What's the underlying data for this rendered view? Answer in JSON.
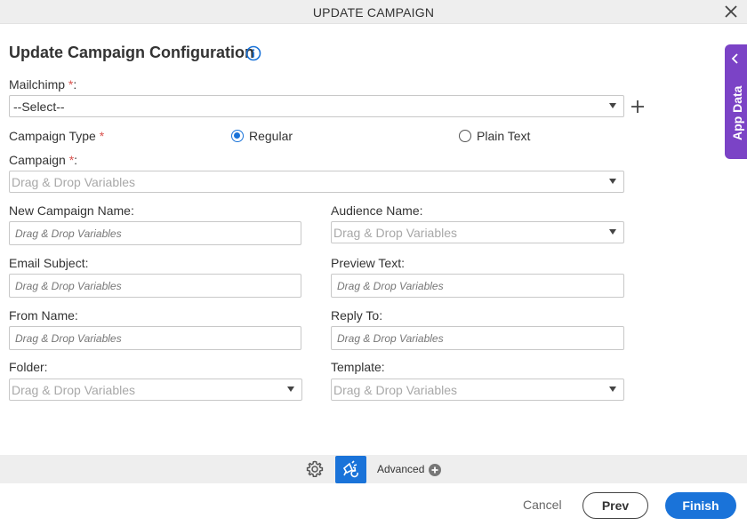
{
  "dialog": {
    "title": "UPDATE CAMPAIGN"
  },
  "heading": "Update Campaign Configuration",
  "mailchimp": {
    "label": "Mailchimp ",
    "required": "*",
    "suffix": ":",
    "value": "--Select--"
  },
  "campaign_type": {
    "label": "Campaign Type ",
    "required": "*",
    "options": [
      {
        "label": "Regular",
        "selected": true
      },
      {
        "label": "Plain Text",
        "selected": false
      }
    ]
  },
  "campaign": {
    "label": "Campaign ",
    "required": "*",
    "suffix": ":",
    "placeholder": "Drag & Drop Variables"
  },
  "fields": {
    "new_campaign_name": {
      "label": "New Campaign Name:",
      "placeholder": "Drag & Drop Variables"
    },
    "audience_name": {
      "label": "Audience Name:",
      "placeholder": "Drag & Drop Variables"
    },
    "email_subject": {
      "label": "Email Subject:",
      "placeholder": "Drag & Drop Variables"
    },
    "preview_text": {
      "label": "Preview Text:",
      "placeholder": "Drag & Drop Variables"
    },
    "from_name": {
      "label": "From Name:",
      "placeholder": "Drag & Drop Variables"
    },
    "reply_to": {
      "label": "Reply To:",
      "placeholder": "Drag & Drop Variables"
    },
    "folder": {
      "label": "Folder:",
      "placeholder": "Drag & Drop Variables"
    },
    "template": {
      "label": "Template:",
      "placeholder": "Drag & Drop Variables"
    }
  },
  "app_data": {
    "label": "App Data"
  },
  "toolbar": {
    "advanced_label": "Advanced"
  },
  "footer": {
    "cancel_label": "Cancel",
    "prev_label": "Prev",
    "finish_label": "Finish"
  },
  "colors": {
    "accent": "#1a73d9",
    "app_data_tab": "#7b43c6",
    "required": "#d9534f"
  },
  "icons": [
    "close-icon",
    "info-icon",
    "plus-icon",
    "chevron-left-icon",
    "gear-icon",
    "variable-mapping-icon",
    "plus-circle-icon",
    "dropdown-arrow-icon"
  ]
}
